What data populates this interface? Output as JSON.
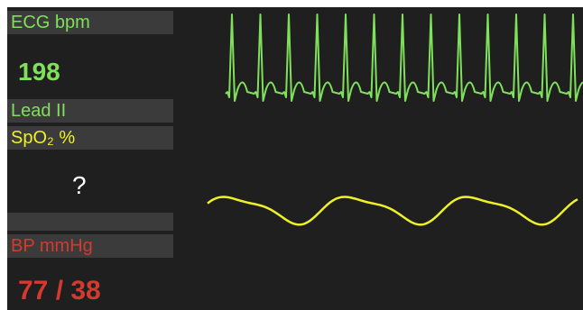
{
  "colors": {
    "ecg": "#7fe05a",
    "spo2": "#eef02a",
    "bp": "#d43a2f",
    "spo2_value": "#ffffff"
  },
  "ecg": {
    "label": "ECG bpm",
    "value": "198",
    "lead": "Lead II"
  },
  "spo2": {
    "label": "SpO₂ %",
    "value": "?"
  },
  "bp": {
    "label": "BP mmHg",
    "value": "77 / 38"
  }
}
